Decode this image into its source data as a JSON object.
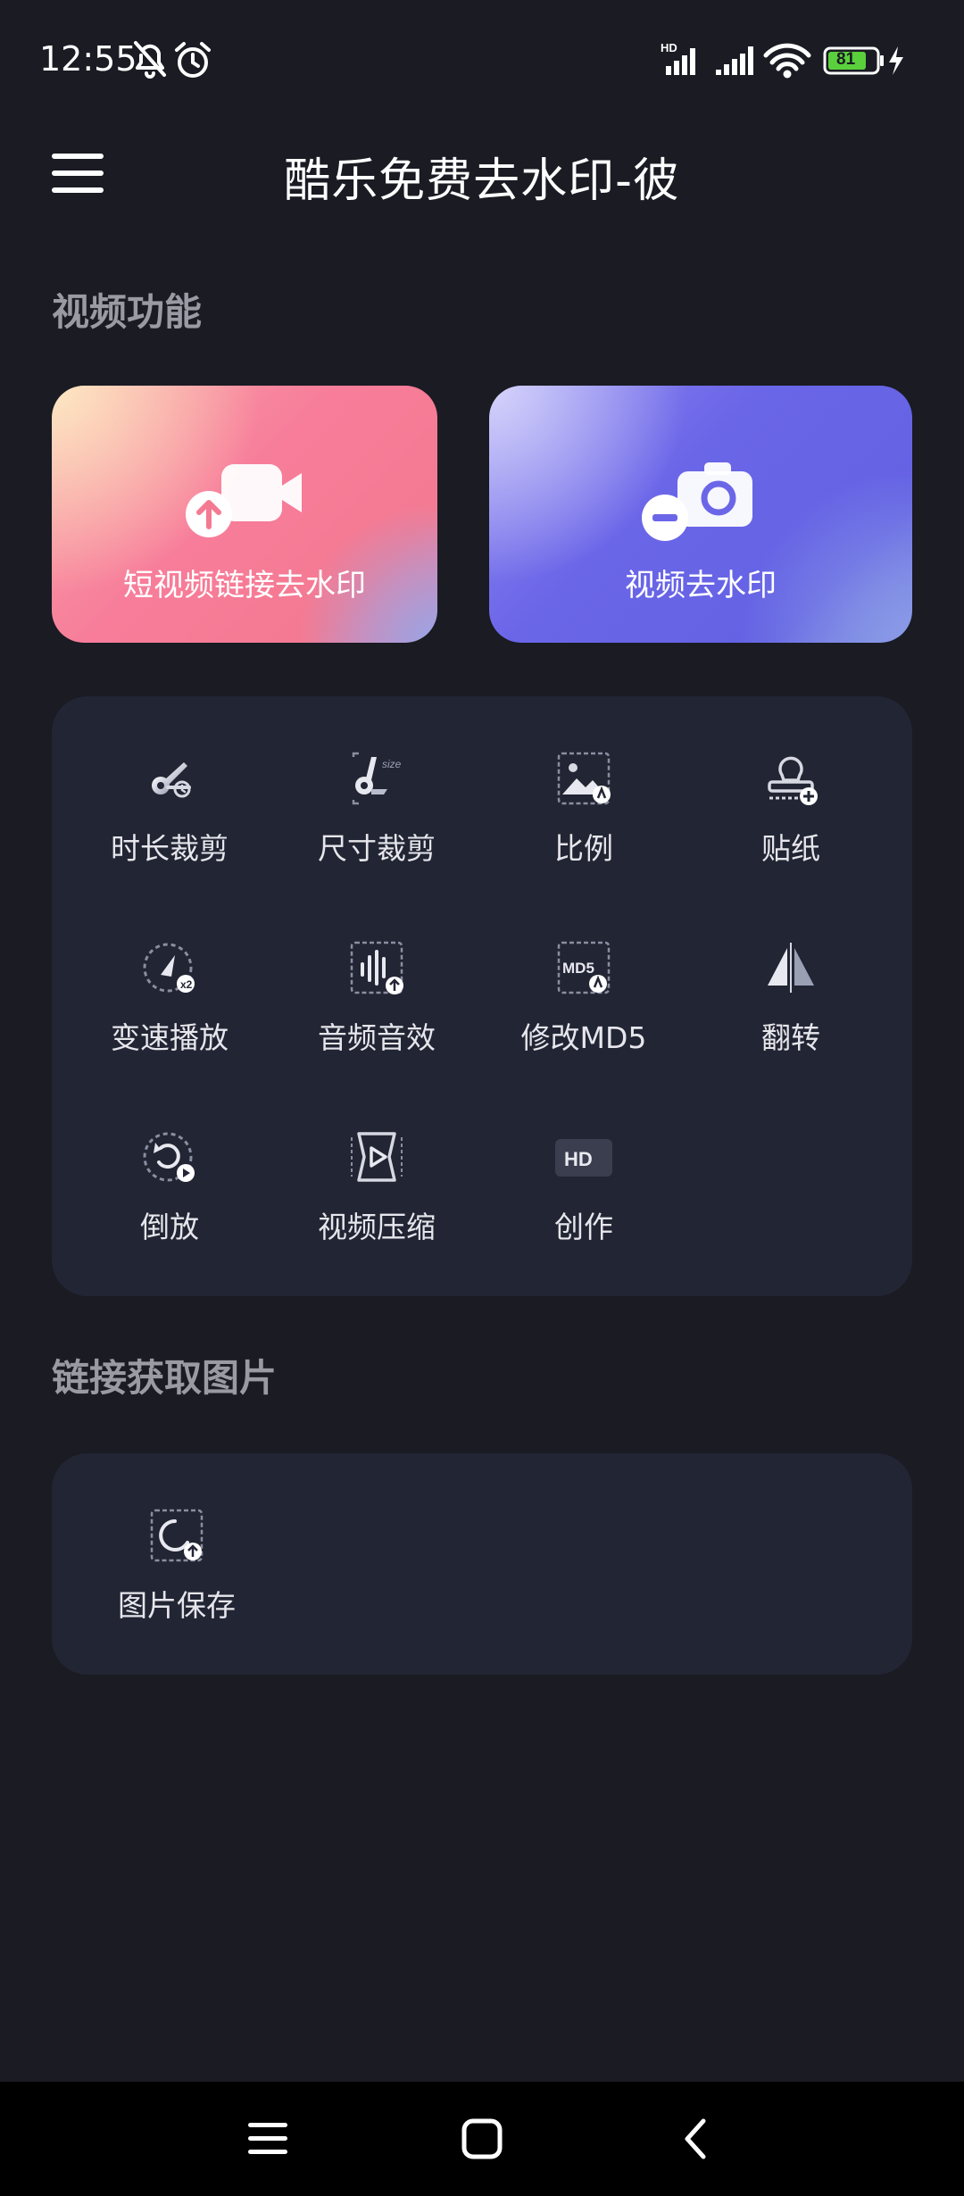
{
  "status_bar": {
    "time": "12:55",
    "battery": "81",
    "icons": [
      "bell-off-icon",
      "alarm-icon",
      "hd-signal-icon",
      "signal-icon",
      "wifi-icon",
      "battery-icon",
      "charging-icon"
    ]
  },
  "app_bar": {
    "title": "酷乐免费去水印-彼"
  },
  "video_section": {
    "title": "视频功能",
    "cards": [
      {
        "label": "短视频链接去水印",
        "icon": "video-camera-upload-icon"
      },
      {
        "label": "视频去水印",
        "icon": "camera-minus-icon"
      }
    ],
    "tools": [
      {
        "label": "时长裁剪",
        "icon": "scissors-clock-icon"
      },
      {
        "label": "尺寸裁剪",
        "icon": "scissors-size-icon"
      },
      {
        "label": "比例",
        "icon": "image-ratio-icon"
      },
      {
        "label": "贴纸",
        "icon": "sticker-stamp-icon"
      },
      {
        "label": "变速播放",
        "icon": "speed-gauge-icon"
      },
      {
        "label": "音频音效",
        "icon": "audio-wave-icon"
      },
      {
        "label": "修改MD5",
        "icon": "md5-icon"
      },
      {
        "label": "翻转",
        "icon": "flip-icon"
      },
      {
        "label": "倒放",
        "icon": "reverse-play-icon"
      },
      {
        "label": "视频压缩",
        "icon": "video-compress-icon"
      },
      {
        "label": "创作",
        "icon": "hd-badge-icon"
      }
    ],
    "md5_badge_text": "MD5",
    "hd_badge_text": "HD",
    "size_badge_text": "size"
  },
  "image_section": {
    "title": "链接获取图片",
    "tools": [
      {
        "label": "图片保存",
        "icon": "image-save-icon"
      }
    ]
  },
  "nav_bar": {
    "buttons": [
      "recent-apps",
      "home",
      "back"
    ]
  },
  "colors": {
    "background": "#1a1b23",
    "panel": "#222533",
    "section_title": "#9a9aa4",
    "pink_card": "#f77d9a",
    "blue_card": "#6b66e8",
    "battery_fill": "#5ad03c"
  }
}
